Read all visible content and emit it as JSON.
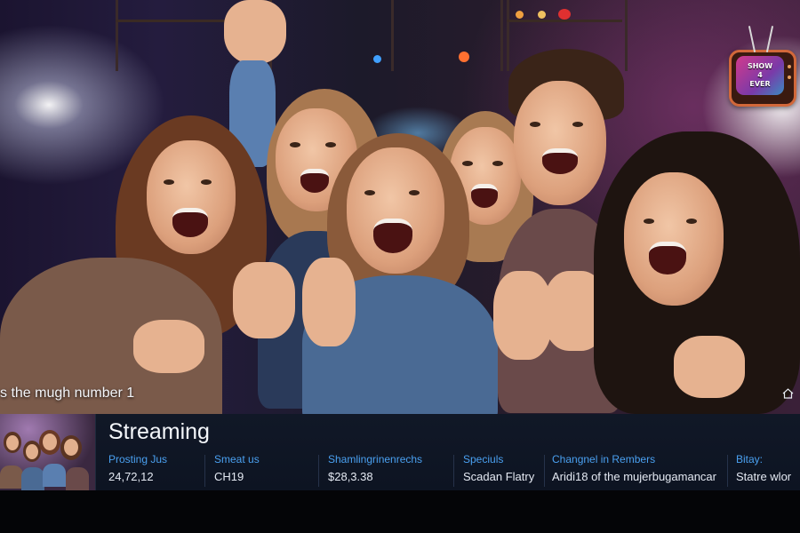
{
  "overlay": {
    "caption": "s the mugh number 1",
    "logo_text_line1": "SHOW",
    "logo_text_line2": "4",
    "logo_text_line3": "EVER"
  },
  "info_panel": {
    "title": "Streaming",
    "stats": [
      {
        "label": "Prosting Jus",
        "value": "24,72,12"
      },
      {
        "label": "Smeat us",
        "value": "CH19"
      },
      {
        "label": "Shamlingrinenrechs",
        "value": "$28,3.38"
      },
      {
        "label": "Speciuls",
        "value": "Scadan Flatry"
      },
      {
        "label": "Changnel in Rembers",
        "value": "Aridi18 of the mujerbugamancar"
      },
      {
        "label": "Bitay:",
        "value": "Statre wlor"
      }
    ]
  },
  "icons": {
    "home": "home-icon"
  },
  "colors": {
    "accent_label": "#4aa0f0",
    "panel_bg": "#111827",
    "logo_border": "#d2683a"
  }
}
